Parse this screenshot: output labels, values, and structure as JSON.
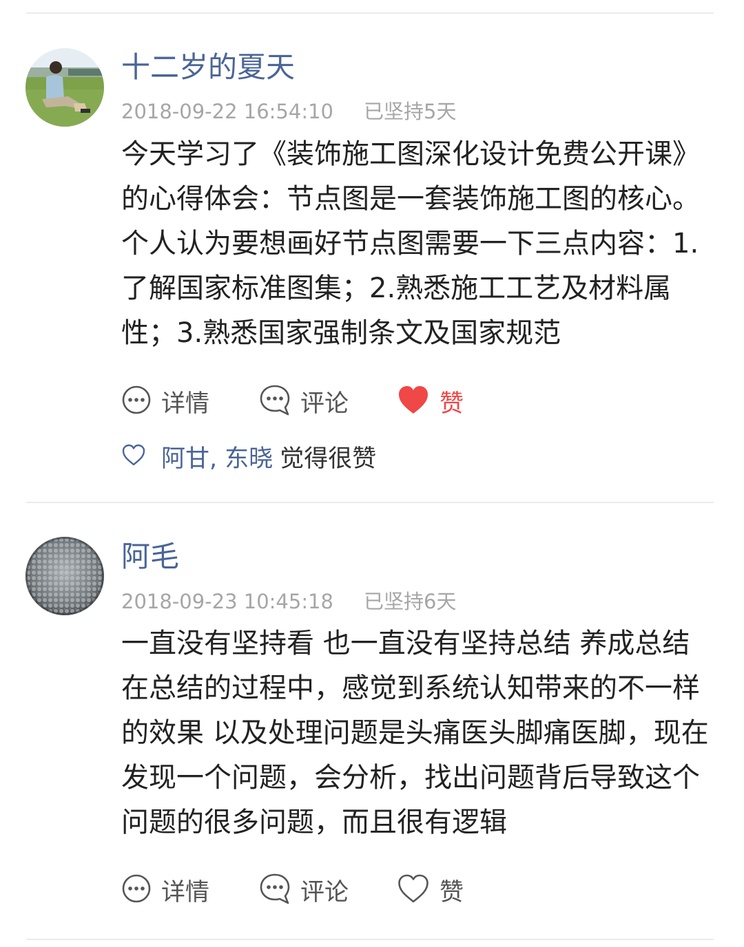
{
  "posts": [
    {
      "author": "十二岁的夏天",
      "timestamp": "2018-09-22 16:54:10",
      "streak": "已坚持5天",
      "content": "今天学习了《装饰施工图深化设计免费公开课》的心得体会：节点图是一套装饰施工图的核心。个人认为要想画好节点图需要一下三点内容：1.了解国家标准图集；2.熟悉施工工艺及材料属性；3.熟悉国家强制条文及国家规范",
      "actions": {
        "detail": "详情",
        "comment": "评论",
        "like": "赞"
      },
      "liked": true,
      "likers": {
        "names": "阿甘, 东晓",
        "suffix": "觉得很赞"
      }
    },
    {
      "author": "阿毛",
      "timestamp": "2018-09-23 10:45:18",
      "streak": "已坚持6天",
      "content": "一直没有坚持看 也一直没有坚持总结 养成总结 在总结的过程中，感觉到系统认知带来的不一样的效果 以及处理问题是头痛医头脚痛医脚，现在发现一个问题，会分析，找出问题背后导致这个问题的很多问题，而且很有逻辑",
      "actions": {
        "detail": "详情",
        "comment": "评论",
        "like": "赞"
      },
      "liked": false
    }
  ],
  "icons": {
    "detail": "more-circle-icon",
    "comment": "comment-bubble-icon",
    "like_filled": "heart-filled-icon",
    "like_outline": "heart-outline-icon",
    "likers": "heart-small-outline-icon"
  },
  "colors": {
    "author": "#4a6597",
    "meta": "#a6a6a6",
    "text": "#222222",
    "action": "#555555",
    "liked": "#f04747",
    "divider": "#ebebeb"
  }
}
